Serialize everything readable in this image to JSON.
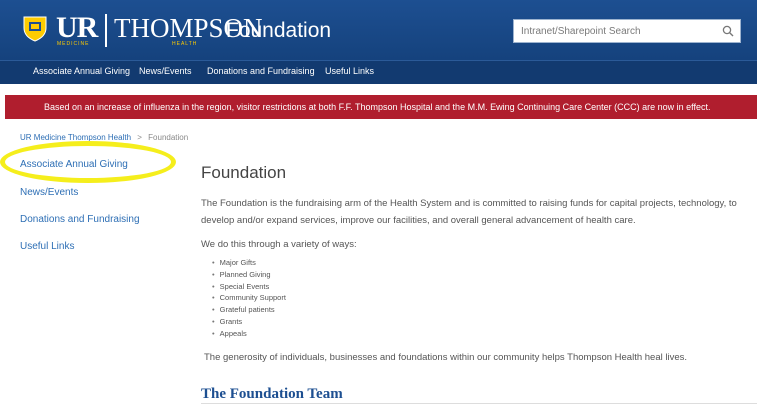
{
  "header": {
    "logo": {
      "ur": "UR",
      "medicine": "MEDICINE",
      "thompson": "THOMPSON",
      "health": "HEALTH"
    },
    "site_title": "Foundation",
    "search": {
      "placeholder": "Intranet/Sharepoint Search",
      "icon": "search-icon"
    }
  },
  "nav": {
    "items": [
      {
        "label": "Associate Annual Giving"
      },
      {
        "label": "News/Events"
      },
      {
        "label": "Donations and Fundraising"
      },
      {
        "label": "Useful Links"
      }
    ]
  },
  "alert": {
    "text": "Based on an increase of influenza in the region, visitor restrictions at both F.F. Thompson Hospital and the M.M. Ewing Continuing Care Center (CCC) are now in effect.",
    "color": "#b01e2e"
  },
  "breadcrumb": {
    "items": [
      {
        "label": "UR Medicine Thompson Health"
      },
      {
        "label": "Foundation"
      }
    ],
    "separator": ">"
  },
  "sidebar": {
    "items": [
      {
        "label": "Associate Annual Giving"
      },
      {
        "label": "News/Events"
      },
      {
        "label": "Donations and Fundraising"
      },
      {
        "label": "Useful Links"
      }
    ],
    "highlight_color": "#f5ee1c"
  },
  "main": {
    "title": "Foundation",
    "intro": "The Foundation is the fundraising arm of the Health System and is committed to raising funds for capital projects, technology, to develop and/or expand services, improve our facilities, and overall general advancement of health care.",
    "ways_intro": "We do this through a variety of ways:",
    "ways": [
      "Major Gifts",
      "Planned Giving",
      "Special Events",
      "Community Support",
      "Grateful patients",
      "Grants",
      "Appeals"
    ],
    "closing": "The generosity of individuals, businesses and foundations within our community helps Thompson Health heal lives.",
    "section_title": "The Foundation Team"
  },
  "colors": {
    "header": "#1d4f91",
    "nav": "#123a70",
    "link": "#2e6fb5"
  }
}
